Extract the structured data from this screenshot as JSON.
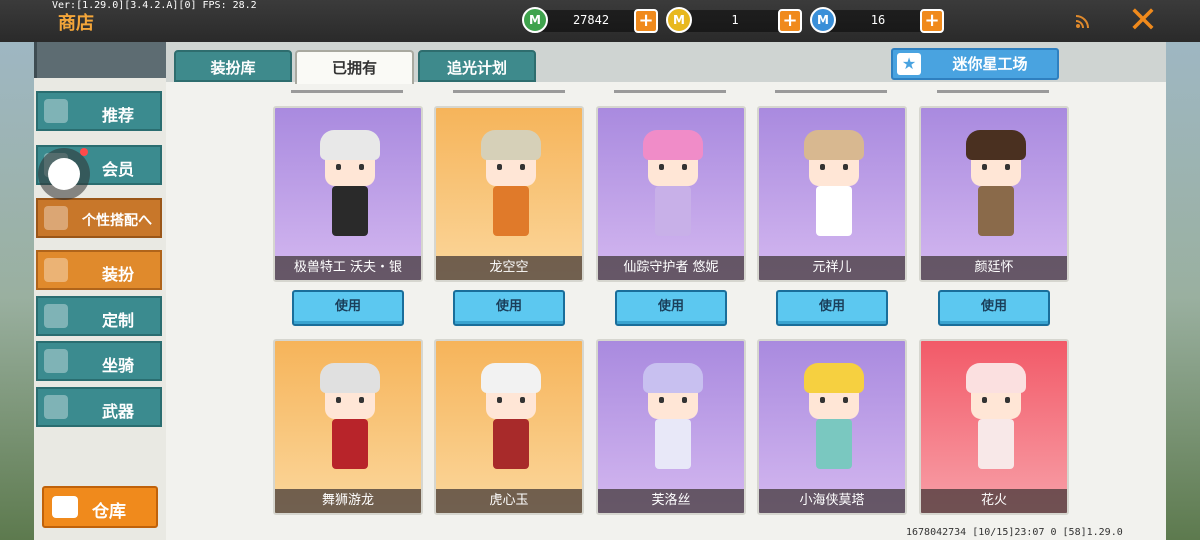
{
  "header": {
    "version": "Ver:[1.29.0][3.4.2.A][0] FPS: 28.2",
    "title": "商店",
    "currencies": [
      {
        "icon": "mini-bean-icon",
        "value": "27842",
        "color": "#3fa34d"
      },
      {
        "icon": "mini-coin-icon",
        "value": "1",
        "color": "#e8b81e"
      },
      {
        "icon": "mini-point-icon",
        "value": "16",
        "color": "#3a8fd8"
      }
    ]
  },
  "tabs": [
    {
      "label": "装扮库",
      "active": false
    },
    {
      "label": "已拥有",
      "active": true
    },
    {
      "label": "追光计划",
      "active": false
    }
  ],
  "workshop_label": "迷你星工场",
  "sidebar": {
    "items": [
      {
        "label": "推荐"
      },
      {
        "label": "会员"
      },
      {
        "label": "个性搭配へ"
      },
      {
        "label": "装扮"
      },
      {
        "label": "定制"
      },
      {
        "label": "坐骑"
      },
      {
        "label": "武器"
      }
    ],
    "warehouse_label": "仓库"
  },
  "use_label": "使用",
  "cards": [
    {
      "name": "极兽特工 沃夫・银",
      "theme": "purple",
      "hair": "#e8e8e8",
      "body": "#2a2a2a"
    },
    {
      "name": "龙空空",
      "theme": "orange",
      "hair": "#d6d0b8",
      "body": "#e07a2a"
    },
    {
      "name": "仙踪守护者 悠妮",
      "theme": "purple",
      "hair": "#f08cc8",
      "body": "#c8b0e8"
    },
    {
      "name": "元祥儿",
      "theme": "purple",
      "hair": "#d8b890",
      "body": "#ffffff"
    },
    {
      "name": "颜廷怀",
      "theme": "purple",
      "hair": "#4a3020",
      "body": "#8a6a4a"
    },
    {
      "name": "舞狮游龙",
      "theme": "orange",
      "hair": "#e0e0e0",
      "body": "#b8242a"
    },
    {
      "name": "虎心玉",
      "theme": "orange",
      "hair": "#f2f2f2",
      "body": "#a82a2a"
    },
    {
      "name": "芙洛丝",
      "theme": "purple",
      "hair": "#c8c0f0",
      "body": "#e8e8f8"
    },
    {
      "name": "小海侠莫塔",
      "theme": "purple",
      "hair": "#f6d040",
      "body": "#7ac8c0"
    },
    {
      "name": "花火",
      "theme": "red",
      "hair": "#fbe0e0",
      "body": "#f8e8e8"
    }
  ],
  "footer": "1678042734  [10/15]23:07 0  [58]1.29.0"
}
